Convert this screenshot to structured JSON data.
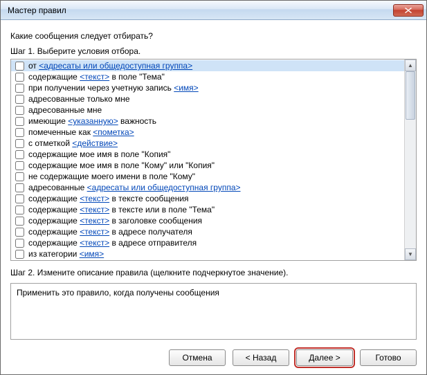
{
  "window": {
    "title": "Мастер правил"
  },
  "prompt": "Какие сообщения следует отбирать?",
  "step1_label": "Шаг 1. Выберите условия отбора.",
  "conditions": [
    {
      "selected": true,
      "segments": [
        {
          "t": "от "
        },
        {
          "t": "<адресаты или общедоступная группа>",
          "link": true
        }
      ]
    },
    {
      "selected": false,
      "segments": [
        {
          "t": "содержащие "
        },
        {
          "t": "<текст>",
          "link": true
        },
        {
          "t": " в поле \"Тема\""
        }
      ]
    },
    {
      "selected": false,
      "segments": [
        {
          "t": "при получении через учетную запись "
        },
        {
          "t": "<имя>",
          "link": true
        }
      ]
    },
    {
      "selected": false,
      "segments": [
        {
          "t": "адресованные только мне"
        }
      ]
    },
    {
      "selected": false,
      "segments": [
        {
          "t": "адресованные мне"
        }
      ]
    },
    {
      "selected": false,
      "segments": [
        {
          "t": "имеющие "
        },
        {
          "t": "<указанную>",
          "link": true
        },
        {
          "t": " важность"
        }
      ]
    },
    {
      "selected": false,
      "segments": [
        {
          "t": "помеченные как "
        },
        {
          "t": "<пометка>",
          "link": true
        }
      ]
    },
    {
      "selected": false,
      "segments": [
        {
          "t": "с отметкой "
        },
        {
          "t": "<действие>",
          "link": true
        }
      ]
    },
    {
      "selected": false,
      "segments": [
        {
          "t": "содержащие мое имя в поле \"Копия\""
        }
      ]
    },
    {
      "selected": false,
      "segments": [
        {
          "t": "содержащие мое имя в поле \"Кому\" или \"Копия\""
        }
      ]
    },
    {
      "selected": false,
      "segments": [
        {
          "t": "не содержащие моего имени в поле \"Кому\""
        }
      ]
    },
    {
      "selected": false,
      "segments": [
        {
          "t": "адресованные "
        },
        {
          "t": "<адресаты или общедоступная группа>",
          "link": true
        }
      ]
    },
    {
      "selected": false,
      "segments": [
        {
          "t": "содержащие "
        },
        {
          "t": "<текст>",
          "link": true
        },
        {
          "t": " в тексте сообщения"
        }
      ]
    },
    {
      "selected": false,
      "segments": [
        {
          "t": "содержащие "
        },
        {
          "t": "<текст>",
          "link": true
        },
        {
          "t": " в тексте или в поле \"Тема\""
        }
      ]
    },
    {
      "selected": false,
      "segments": [
        {
          "t": "содержащие "
        },
        {
          "t": "<текст>",
          "link": true
        },
        {
          "t": " в заголовке сообщения"
        }
      ]
    },
    {
      "selected": false,
      "segments": [
        {
          "t": "содержащие "
        },
        {
          "t": "<текст>",
          "link": true
        },
        {
          "t": " в адресе получателя"
        }
      ]
    },
    {
      "selected": false,
      "segments": [
        {
          "t": "содержащие "
        },
        {
          "t": "<текст>",
          "link": true
        },
        {
          "t": " в адресе отправителя"
        }
      ]
    },
    {
      "selected": false,
      "segments": [
        {
          "t": "из категории "
        },
        {
          "t": "<имя>",
          "link": true
        }
      ]
    }
  ],
  "step2_label": "Шаг 2. Измените описание правила (щелкните подчеркнутое значение).",
  "description": "Применить это правило, когда получены сообщения",
  "buttons": {
    "cancel": "Отмена",
    "back": "< Назад",
    "next": "Далее >",
    "finish": "Готово"
  }
}
